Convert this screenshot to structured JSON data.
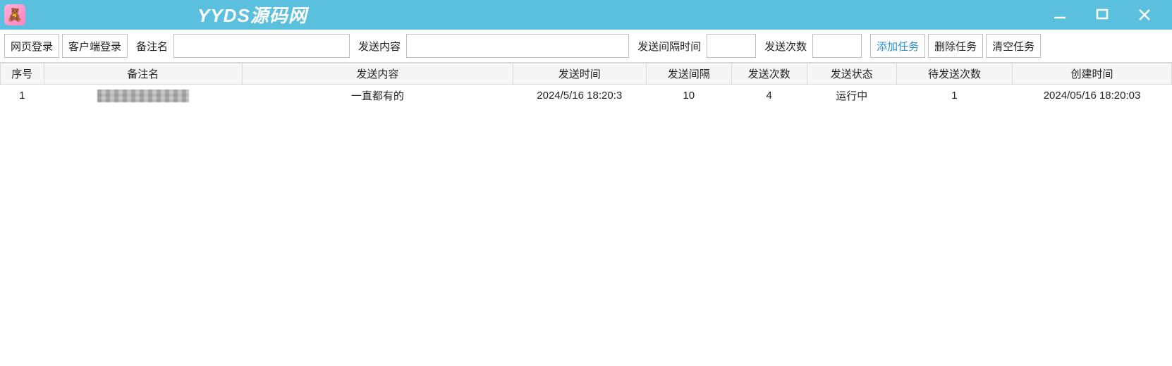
{
  "watermark": "YYDS源码网",
  "toolbar": {
    "web_login": "网页登录",
    "client_login": "客户端登录",
    "label_note": "备注名",
    "label_content": "发送内容",
    "label_interval": "发送间隔时间",
    "label_count": "发送次数",
    "add_task": "添加任务",
    "delete_task": "删除任务",
    "clear_task": "清空任务",
    "input_note": "",
    "input_content": "",
    "input_interval": "",
    "input_count": ""
  },
  "columns": {
    "seq": "序号",
    "note": "备注名",
    "content": "发送内容",
    "send_time": "发送时间",
    "interval": "发送间隔",
    "count": "发送次数",
    "status": "发送状态",
    "pending": "待发送次数",
    "created": "创建时间"
  },
  "rows": [
    {
      "seq": "1",
      "note": "",
      "content": "一直都有的",
      "send_time": "2024/5/16 18:20:3",
      "interval": "10",
      "count": "4",
      "status": "运行中",
      "pending": "1",
      "created": "2024/05/16 18:20:03"
    }
  ]
}
